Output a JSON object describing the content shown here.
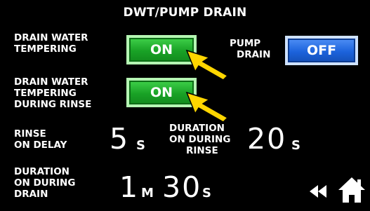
{
  "title": "DWT/PUMP DRAIN",
  "drain_water_tempering": {
    "label_line1": "DRAIN WATER",
    "label_line2": "TEMPERING",
    "toggle_label": "ON"
  },
  "pump_drain": {
    "label_line1": "PUMP",
    "label_line2": "DRAIN",
    "toggle_label": "OFF"
  },
  "drain_water_tempering_rinse": {
    "label_line1": "DRAIN WATER",
    "label_line2": "TEMPERING",
    "label_line3": "DURING RINSE",
    "toggle_label": "ON"
  },
  "rinse_on_delay": {
    "label_line1": "RINSE",
    "label_line2": "ON DELAY",
    "value": "5",
    "unit": "S"
  },
  "duration_rinse": {
    "label_line1": "DURATION",
    "label_line2": "ON DURING",
    "label_line3": "RINSE",
    "value": "20",
    "unit": "S"
  },
  "duration_drain": {
    "label_line1": "DURATION",
    "label_line2": "ON DURING",
    "label_line3": "DRAIN",
    "minutes_value": "1",
    "minutes_unit": "M",
    "seconds_value": "30",
    "seconds_unit": "S"
  },
  "colors": {
    "on_green": "#1fae2a",
    "off_blue": "#1c63dc",
    "arrow_yellow": "#ffd600"
  },
  "icons": [
    "yellow-arrow-icon",
    "back-rewind-icon",
    "home-icon"
  ]
}
